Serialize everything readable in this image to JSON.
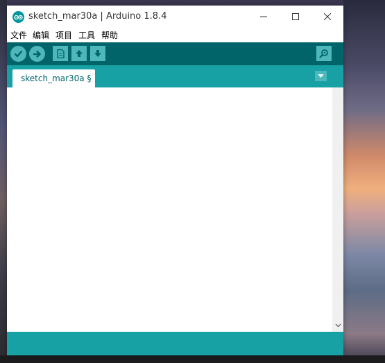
{
  "window": {
    "title": "sketch_mar30a | Arduino 1.8.4",
    "app_icon": "arduino-logo-icon",
    "controls": [
      "minimize-icon",
      "maximize-icon",
      "close-icon"
    ]
  },
  "menu": {
    "items": [
      "文件",
      "编辑",
      "项目",
      "工具",
      "帮助"
    ]
  },
  "toolbar": {
    "buttons": [
      "verify-icon",
      "upload-icon",
      "new-icon",
      "open-icon",
      "save-icon"
    ],
    "right_button": "serial-monitor-icon"
  },
  "tabs": {
    "items": [
      {
        "label": "sketch_mar30a §"
      }
    ],
    "menu_icon": "tab-menu-icon"
  },
  "editor": {
    "content": ""
  },
  "colors": {
    "toolbar": "#006468",
    "tabbar": "#17a1a5",
    "button": "#4db7bb",
    "status": "#17a1a5"
  }
}
